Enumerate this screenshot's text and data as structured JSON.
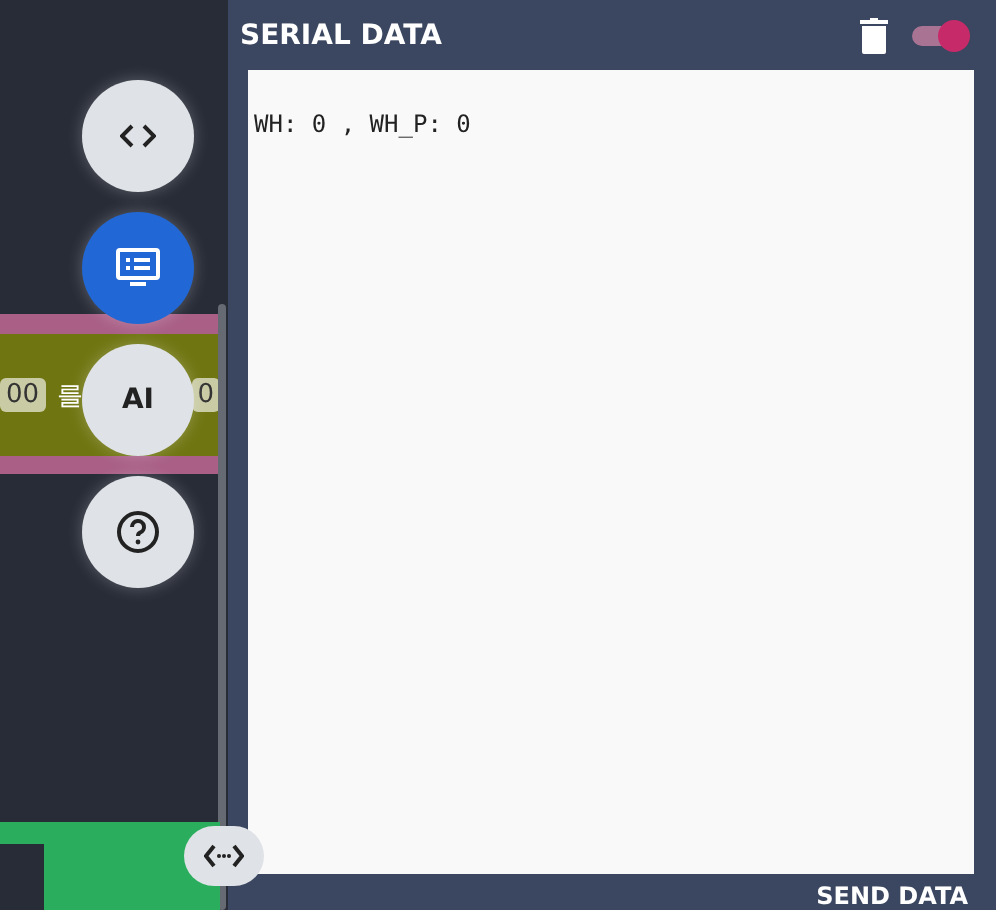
{
  "canvas": {
    "block": {
      "left_value": "00",
      "particle": "를",
      "right_value": "0"
    }
  },
  "floating_buttons": [
    {
      "kind": "code",
      "selected": false
    },
    {
      "kind": "serial",
      "selected": true
    },
    {
      "kind": "ai",
      "label": "AI",
      "selected": false
    },
    {
      "kind": "help",
      "selected": false
    }
  ],
  "serial_panel": {
    "title": "SERIAL DATA",
    "auto_scroll": {
      "on": true
    },
    "output": "WH: 0 , WH_P: 0",
    "send_label": "SEND DATA"
  }
}
